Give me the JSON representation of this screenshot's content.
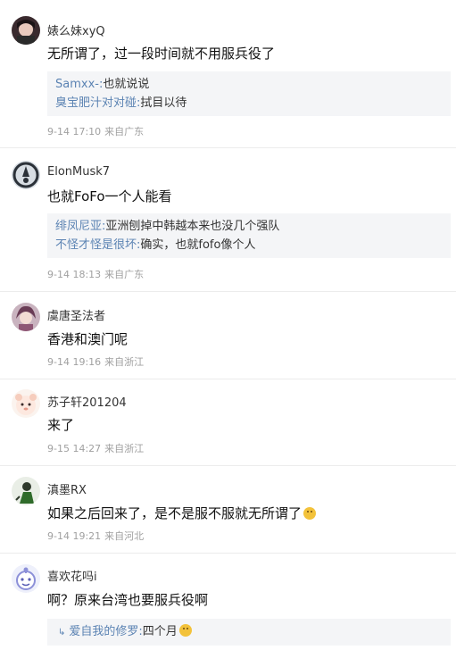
{
  "comments": [
    {
      "username": "婊么妹xyQ",
      "text": "无所谓了，过一段时间就不用服兵役了",
      "replies": [
        {
          "name": "Samxx-",
          "text": "也就说说"
        },
        {
          "name": "臭宝肥汁对对碰",
          "text": "拭目以待"
        }
      ],
      "date": "9-14 17:10",
      "location": "来自广东"
    },
    {
      "username": "ElonMusk7",
      "text": "也就FoFo一个人能看",
      "replies": [
        {
          "name": "绯凤尼亚",
          "text": "亚洲刨掉中韩越本来也没几个强队"
        },
        {
          "name": "不怪才怪是很坏",
          "text": "确实，也就fofo像个人"
        }
      ],
      "date": "9-14 18:13",
      "location": "来自广东"
    },
    {
      "username": "虞唐圣法者",
      "text": "香港和澳门呢",
      "date": "9-14 19:16",
      "location": "来自浙江"
    },
    {
      "username": "苏子轩201204",
      "text": "来了",
      "date": "9-15 14:27",
      "location": "来自浙江"
    },
    {
      "username": "滇墨RX",
      "text": "如果之后回来了，是不是服不服就无所谓了",
      "date": "9-14 19:21",
      "location": "来自河北"
    },
    {
      "username": "喜欢花吗i",
      "text": "啊？原来台湾也要服兵役啊",
      "replies": [
        {
          "name": "爱自我的修罗",
          "text": "四个月"
        }
      ]
    }
  ],
  "reply_separator": ":",
  "icons": {
    "avatar_1": "avatar-dark-hair-girl",
    "avatar_2": "avatar-person-icon",
    "avatar_3": "avatar-anime-girl",
    "avatar_4": "avatar-cute-animal",
    "avatar_5": "avatar-person-green",
    "avatar_6": "avatar-robot-cartoon",
    "emoji_1": "grin-emoji",
    "emoji_2": "laugh-emoji",
    "reply_arrow": "reply-arrow-icon"
  },
  "colors": {
    "reply_name": "#5b83b3",
    "meta": "#a0a0a0",
    "reply_bg": "#f4f5f7"
  }
}
